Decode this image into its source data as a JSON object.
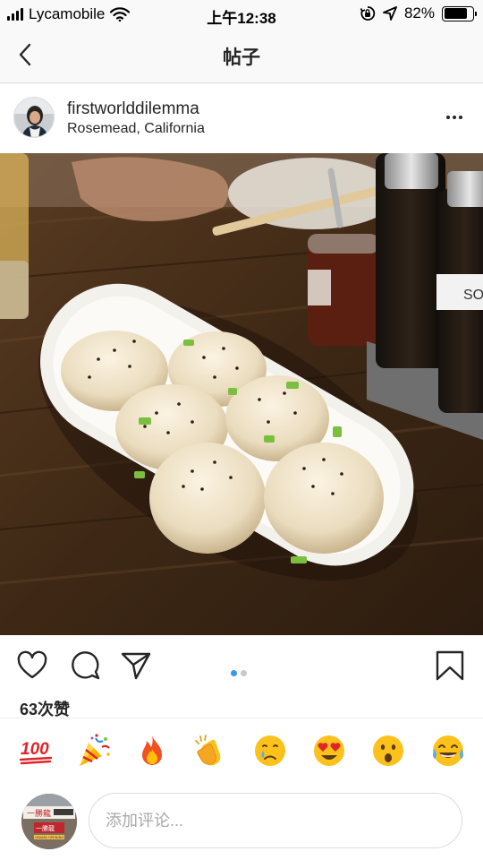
{
  "status_bar": {
    "carrier": "Lycamobile",
    "time": "上午12:38",
    "battery_percent": "82%",
    "battery_level": 0.82,
    "icons": [
      "signal-icon",
      "wifi-icon",
      "orientation-lock-icon",
      "location-arrow-icon",
      "battery-icon"
    ]
  },
  "nav": {
    "title": "帖子",
    "back_icon": "chevron-left-icon"
  },
  "post": {
    "username": "firstworlddilemma",
    "location": "Rosemead, California",
    "more_icon": "more-dots-icon",
    "photo_label": "SO",
    "carousel": {
      "count": 2,
      "active_index": 0
    },
    "action_icons": [
      "heart-icon",
      "comment-icon",
      "share-icon",
      "bookmark-icon"
    ],
    "likes": "63次赞"
  },
  "reactions": [
    {
      "name": "hundred-points-emoji",
      "label": "100"
    },
    {
      "name": "party-popper-emoji"
    },
    {
      "name": "fire-emoji"
    },
    {
      "name": "clapping-hands-emoji"
    },
    {
      "name": "crying-face-emoji"
    },
    {
      "name": "heart-eyes-emoji"
    },
    {
      "name": "surprised-face-emoji"
    },
    {
      "name": "tears-of-joy-emoji"
    }
  ],
  "comment": {
    "placeholder": "添加评论...",
    "avatar_sign": "一勝龍",
    "avatar_banner": "GRAND OPENING"
  },
  "colors": {
    "accent_blue": "#3897f0",
    "text": "#262626",
    "border": "#dbdbdb",
    "placeholder": "#a8a8a8",
    "emoji_yellow": "#fcc21b"
  }
}
